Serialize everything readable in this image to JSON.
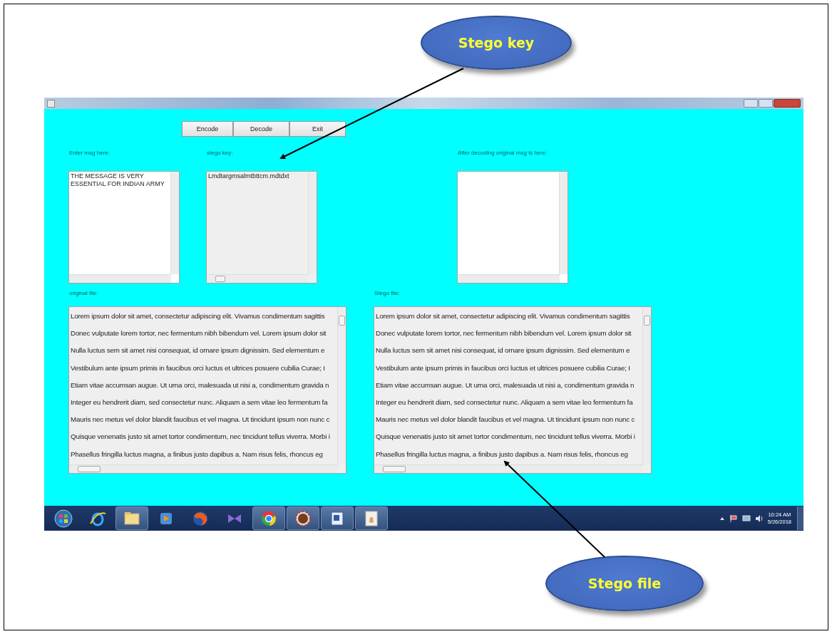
{
  "callouts": [
    {
      "text": "Stego key"
    },
    {
      "text": "Stego file"
    }
  ],
  "window": {
    "buttons": [
      {
        "label": "Encode"
      },
      {
        "label": "Decode"
      },
      {
        "label": "Exit"
      }
    ],
    "top_panels": [
      {
        "label": "Enter msg here:",
        "editable": true,
        "lines": [
          "THE MESSAGE IS VERY",
          "ESSENTIAL FOR INDIAN ARMY"
        ]
      },
      {
        "label": "stego key:",
        "editable": false,
        "lines": [
          "Lmdtargmsalmtbttcm.mdtdxt"
        ]
      },
      {
        "label": "After decoding original msg is here:",
        "editable": true
      }
    ],
    "file_panels": [
      {
        "label": "original file:",
        "editable": false,
        "lines": [
          "Lorem ipsum dolor sit amet, consectetur adipiscing elit. Vivamus condimentum sagittis",
          "Donec vulputate lorem tortor, nec fermentum nibh bibendum vel. Lorem ipsum dolor sit",
          "Nulla luctus sem sit amet nisi consequat, id ornare ipsum dignissim. Sed elementum e",
          "Vestibulum ante ipsum primis in faucibus orci luctus et ultrices posuere cubilia Curae; I",
          "Etiam vitae accumsan augue. Ut urna orci, malesuada ut nisi a, condimentum gravida n",
          "Integer eu hendrerit diam, sed consectetur nunc. Aliquam a sem vitae leo fermentum fa",
          "Mauris nec metus vel dolor blandit faucibus et vel magna. Ut tincidunt ipsum non nunc c",
          "Quisque venenatis justo sit amet tortor condimentum, nec tincidunt tellus viverra. Morbi i",
          "Phasellus fringilla luctus magna, a finibus justo dapibus a. Nam risus felis, rhoncus eg"
        ]
      },
      {
        "label": "Stego file:",
        "editable": false,
        "lines": [
          "Lorem ipsum dolor sit amet, consectetur adipiscing elit. Vivamus condimentum sagittis",
          "Donec vulputate lorem tortor, nec fermentum nibh bibendum vel. Lorem ipsum dolor sit",
          "Nulla luctus sem sit amet nisi consequat, id ornare ipsum dignissim. Sed elementum e",
          "Vestibulum ante ipsum primis in faucibus orci luctus et ultrices posuere cubilia Curae; I",
          "Etiam vitae accumsan augue. Ut urna orci, malesuada ut nisi a, condimentum gravida n",
          "Integer eu hendrerit diam, sed consectetur nunc. Aliquam a sem vitae leo fermentum fa",
          "Mauris nec metus vel dolor blandit faucibus et vel magna. Ut tincidunt ipsum non nunc c",
          "Quisque venenatis justo sit amet tortor condimentum, nec tincidunt tellus viverra. Morbi i",
          "Phasellus fringilla luctus magna, a finibus justo dapibus a. Nam risus felis, rhoncus eg"
        ]
      }
    ]
  },
  "taskbar": {
    "apps": [
      {
        "kind": "start"
      },
      {
        "kind": "browser"
      },
      {
        "kind": "folder"
      },
      {
        "kind": "media"
      },
      {
        "kind": "globe"
      },
      {
        "kind": "bowtie"
      },
      {
        "kind": "chrome"
      },
      {
        "kind": "gear"
      },
      {
        "kind": "document"
      },
      {
        "kind": "java"
      }
    ],
    "time": "10:24 AM",
    "date": "5/26/2018"
  }
}
